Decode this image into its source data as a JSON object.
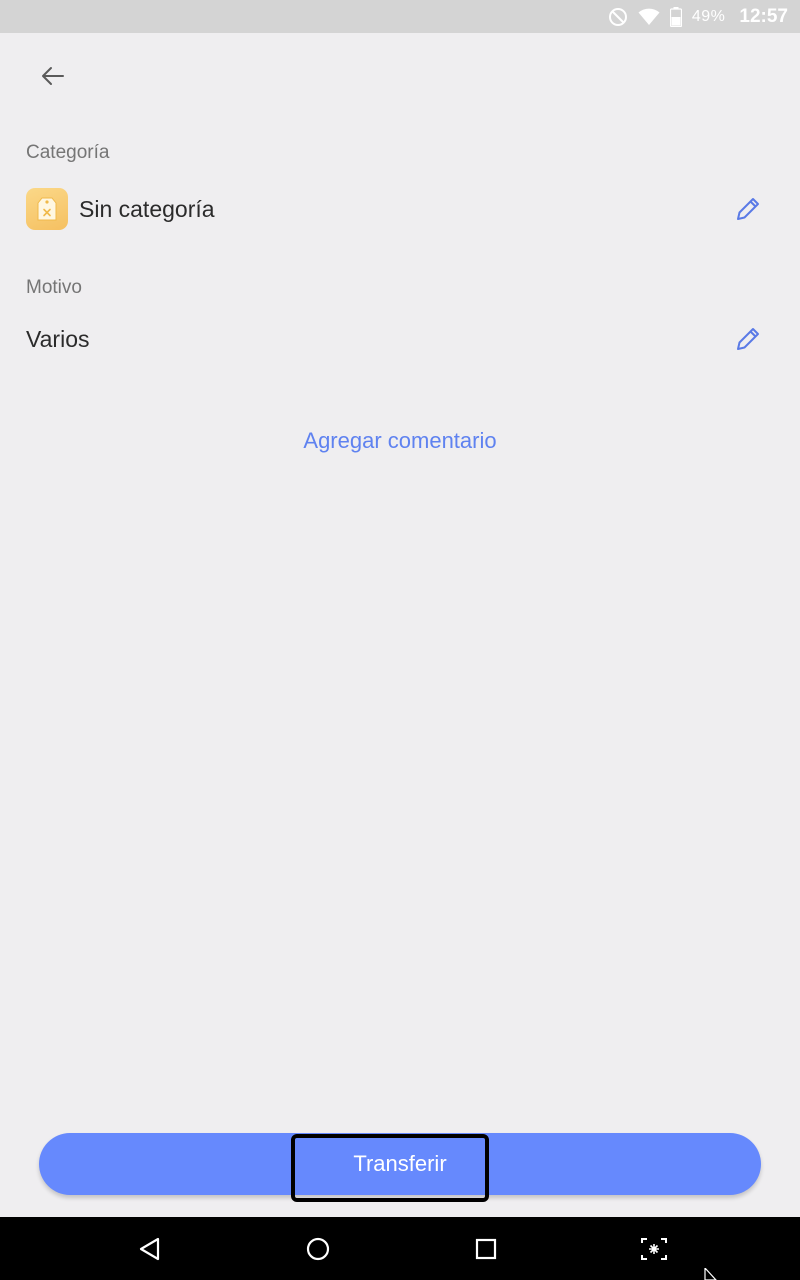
{
  "status_bar": {
    "battery_percent": "49%",
    "time": "12:57",
    "icons": [
      "do-not-disturb-icon",
      "wifi-icon",
      "battery-icon"
    ]
  },
  "header": {
    "back_icon": "arrow-left-icon"
  },
  "category": {
    "label": "Categoría",
    "value": "Sin categoría",
    "icon": "uncategorized-tag-icon",
    "edit_icon": "pencil-icon"
  },
  "reason": {
    "label": "Motivo",
    "value": "Varios",
    "edit_icon": "pencil-icon"
  },
  "add_comment": {
    "label": "Agregar comentario"
  },
  "transfer_button": {
    "label": "Transferir"
  },
  "nav_bar": {
    "icons": [
      "back-triangle-icon",
      "home-circle-icon",
      "recents-square-icon",
      "screenshot-icon"
    ]
  },
  "colors": {
    "accent": "#6689fd",
    "link": "#5f82f0",
    "category_icon": "#f8cc72",
    "background": "#efeef0"
  }
}
